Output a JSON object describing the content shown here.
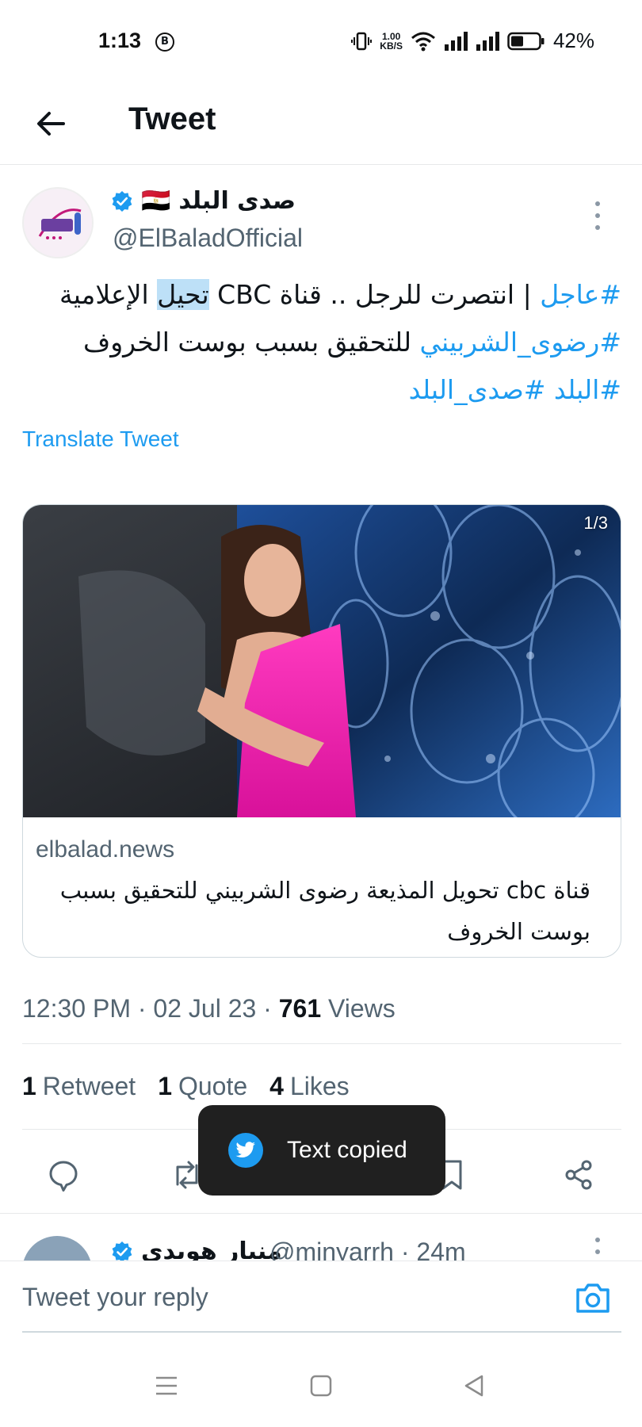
{
  "status_bar": {
    "time": "1:13",
    "b_badge": "B",
    "speed_value": "1.00",
    "speed_unit": "KB/S",
    "battery": "42%"
  },
  "header": {
    "title": "Tweet"
  },
  "tweet": {
    "author_name": "صدى البلد",
    "flag": "🇪🇬",
    "handle": "@ElBaladOfficial",
    "text": {
      "tag_urgent": "#عاجل",
      "part1": " | انتصرت للرجل .. قناة CBC ",
      "highlight": "تحيل",
      "part2": " الإعلامية ",
      "tag_radwa": "#رضوى_الشربيني",
      "part3": " للتحقيق بسبب بوست الخروف ",
      "tag_balad": "#البلد",
      "part4": " ",
      "tag_sada": "#صدى_البلد"
    },
    "translate_label": "Translate Tweet",
    "card": {
      "counter": "1/3",
      "domain": "elbalad.news",
      "title": "قناة cbc تحويل المذيعة رضوى الشربيني للتحقيق بسبب بوست الخروف"
    },
    "time": "12:30 PM",
    "date": "02 Jul 23",
    "views_count": "761",
    "views_label": "Views",
    "retweets_count": "1",
    "retweets_label": "Retweet",
    "quotes_count": "1",
    "quotes_label": "Quote",
    "likes_count": "4",
    "likes_label": "Likes"
  },
  "toast": {
    "text": "Text copied"
  },
  "reply": {
    "name": "منيار هويدي",
    "handle": "@minyarrh · 24m"
  },
  "composer": {
    "placeholder": "Tweet your reply"
  },
  "colors": {
    "accent": "#1d9bf0",
    "text": "#0f1419",
    "muted": "#536471",
    "toast_bg": "#202020"
  }
}
